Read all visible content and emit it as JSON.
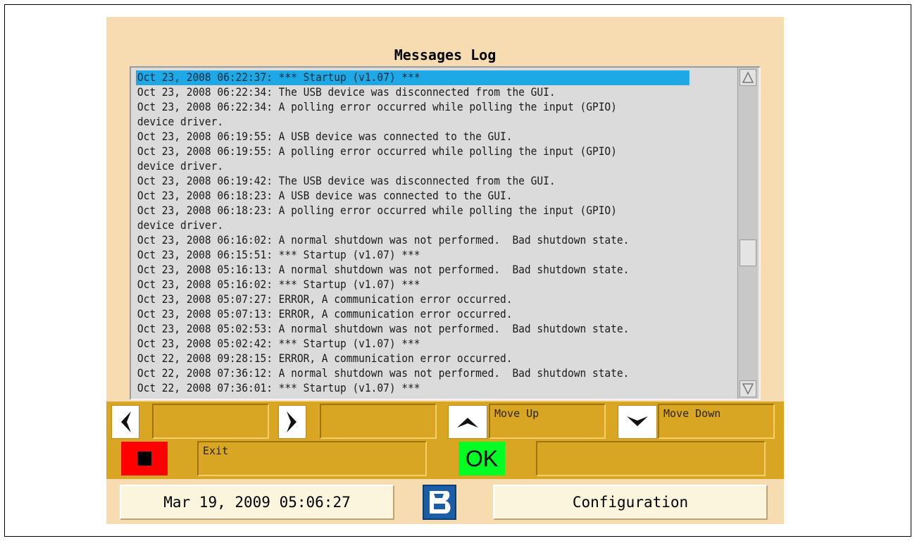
{
  "window": {
    "title": "Messages Log"
  },
  "log": {
    "selected_index": 0,
    "lines": [
      "Oct 23, 2008 06:22:37: *** Startup (v1.07) ***",
      "Oct 23, 2008 06:22:34: The USB device was disconnected from the GUI.",
      "Oct 23, 2008 06:22:34: A polling error occurred while polling the input (GPIO)",
      "device driver.",
      "Oct 23, 2008 06:19:55: A USB device was connected to the GUI.",
      "Oct 23, 2008 06:19:55: A polling error occurred while polling the input (GPIO)",
      "device driver.",
      "Oct 23, 2008 06:19:42: The USB device was disconnected from the GUI.",
      "Oct 23, 2008 06:18:23: A USB device was connected to the GUI.",
      "Oct 23, 2008 06:18:23: A polling error occurred while polling the input (GPIO)",
      "device driver.",
      "Oct 23, 2008 06:16:02: A normal shutdown was not performed.  Bad shutdown state.",
      "Oct 23, 2008 06:15:51: *** Startup (v1.07) ***",
      "Oct 23, 2008 05:16:13: A normal shutdown was not performed.  Bad shutdown state.",
      "Oct 23, 2008 05:16:02: *** Startup (v1.07) ***",
      "Oct 23, 2008 05:07:27: ERROR, A communication error occurred.",
      "Oct 23, 2008 05:07:13: ERROR, A communication error occurred.",
      "Oct 23, 2008 05:02:53: A normal shutdown was not performed.  Bad shutdown state.",
      "Oct 23, 2008 05:02:42: *** Startup (v1.07) ***",
      "Oct 22, 2008 09:28:15: ERROR, A communication error occurred.",
      "Oct 22, 2008 07:36:12: A normal shutdown was not performed.  Bad shutdown state.",
      "Oct 22, 2008 07:36:01: *** Startup (v1.07) ***"
    ]
  },
  "controls": {
    "prev_label": "",
    "next_label": "",
    "move_up_label": "Move Up",
    "move_down_label": "Move Down",
    "exit_label": "Exit",
    "ok_label": "OK",
    "ok_field_label": ""
  },
  "footer": {
    "datetime": "Mar 19, 2009 05:06:27",
    "configuration_label": "Configuration"
  },
  "colors": {
    "panel_bg": "#f6dcb0",
    "control_strip": "#d9a624",
    "selection": "#1fa8e6",
    "exit_button": "#ff0000",
    "ok_button": "#00ff22"
  },
  "icons": [
    "left-arrow-icon",
    "right-arrow-icon",
    "up-arrow-icon",
    "down-arrow-icon",
    "stop-icon",
    "logo-icon",
    "scroll-up-icon",
    "scroll-down-icon"
  ]
}
